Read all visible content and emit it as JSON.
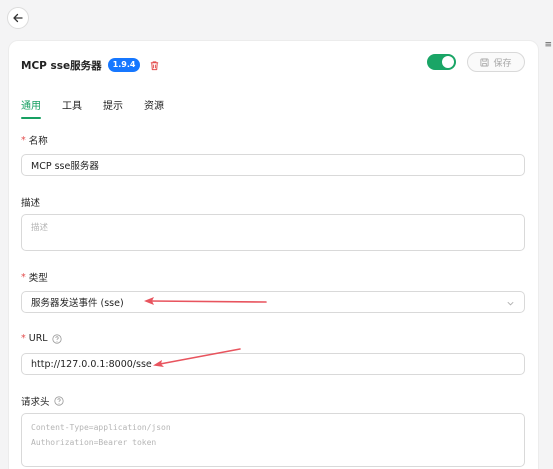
{
  "header": {
    "title": "MCP sse服务器",
    "version": "1.9.4",
    "save_label": "保存",
    "enabled": true
  },
  "tabs": [
    {
      "label": "通用",
      "active": true
    },
    {
      "label": "工具",
      "active": false
    },
    {
      "label": "提示",
      "active": false
    },
    {
      "label": "资源",
      "active": false
    }
  ],
  "form": {
    "name": {
      "label": "名称",
      "required": true,
      "value": "MCP sse服务器"
    },
    "description": {
      "label": "描述",
      "required": false,
      "placeholder": "描述"
    },
    "type": {
      "label": "类型",
      "required": true,
      "value": "服务器发送事件 (sse)"
    },
    "url": {
      "label": "URL",
      "required": true,
      "value": "http://127.0.0.1:8000/sse"
    },
    "headers": {
      "label": "请求头",
      "placeholder_line1": "Content-Type=application/json",
      "placeholder_line2": "Authorization=Bearer token"
    },
    "required_mark": "*"
  },
  "colors": {
    "accent": "#17a062",
    "badge": "#1677ff",
    "danger": "#e34d4d",
    "annotation_arrow": "#e8545e"
  }
}
